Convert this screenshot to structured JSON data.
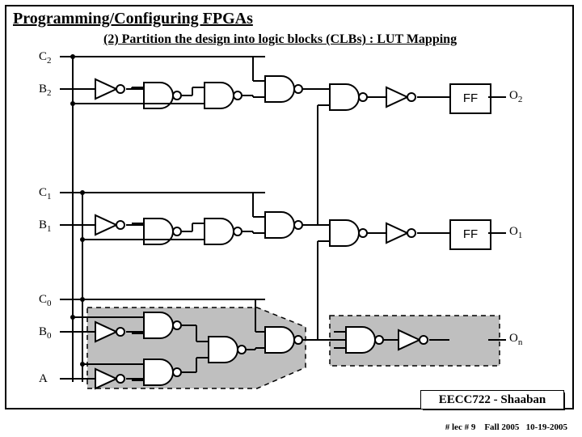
{
  "title": "Programming/Configuring FPGAs",
  "subtitle": "(2) Partition the design into logic blocks (CLBs) : LUT Mapping",
  "signals": {
    "c2": "C",
    "c2_sub": "2",
    "b2": "B",
    "b2_sub": "2",
    "c1": "C",
    "c1_sub": "1",
    "b1": "B",
    "b1_sub": "1",
    "c0": "C",
    "c0_sub": "0",
    "b0": "B",
    "b0_sub": "0",
    "a": "A",
    "q2": "O",
    "q2_sub": "2",
    "q1": "O",
    "q1_sub": "1",
    "qn": "O",
    "qn_sub": "n"
  },
  "ff_label": "FF",
  "attribution": "EECC722 - Shaaban",
  "footer": {
    "lec": "#  lec # 9",
    "term": "Fall 2005",
    "date": "10-19-2005"
  }
}
